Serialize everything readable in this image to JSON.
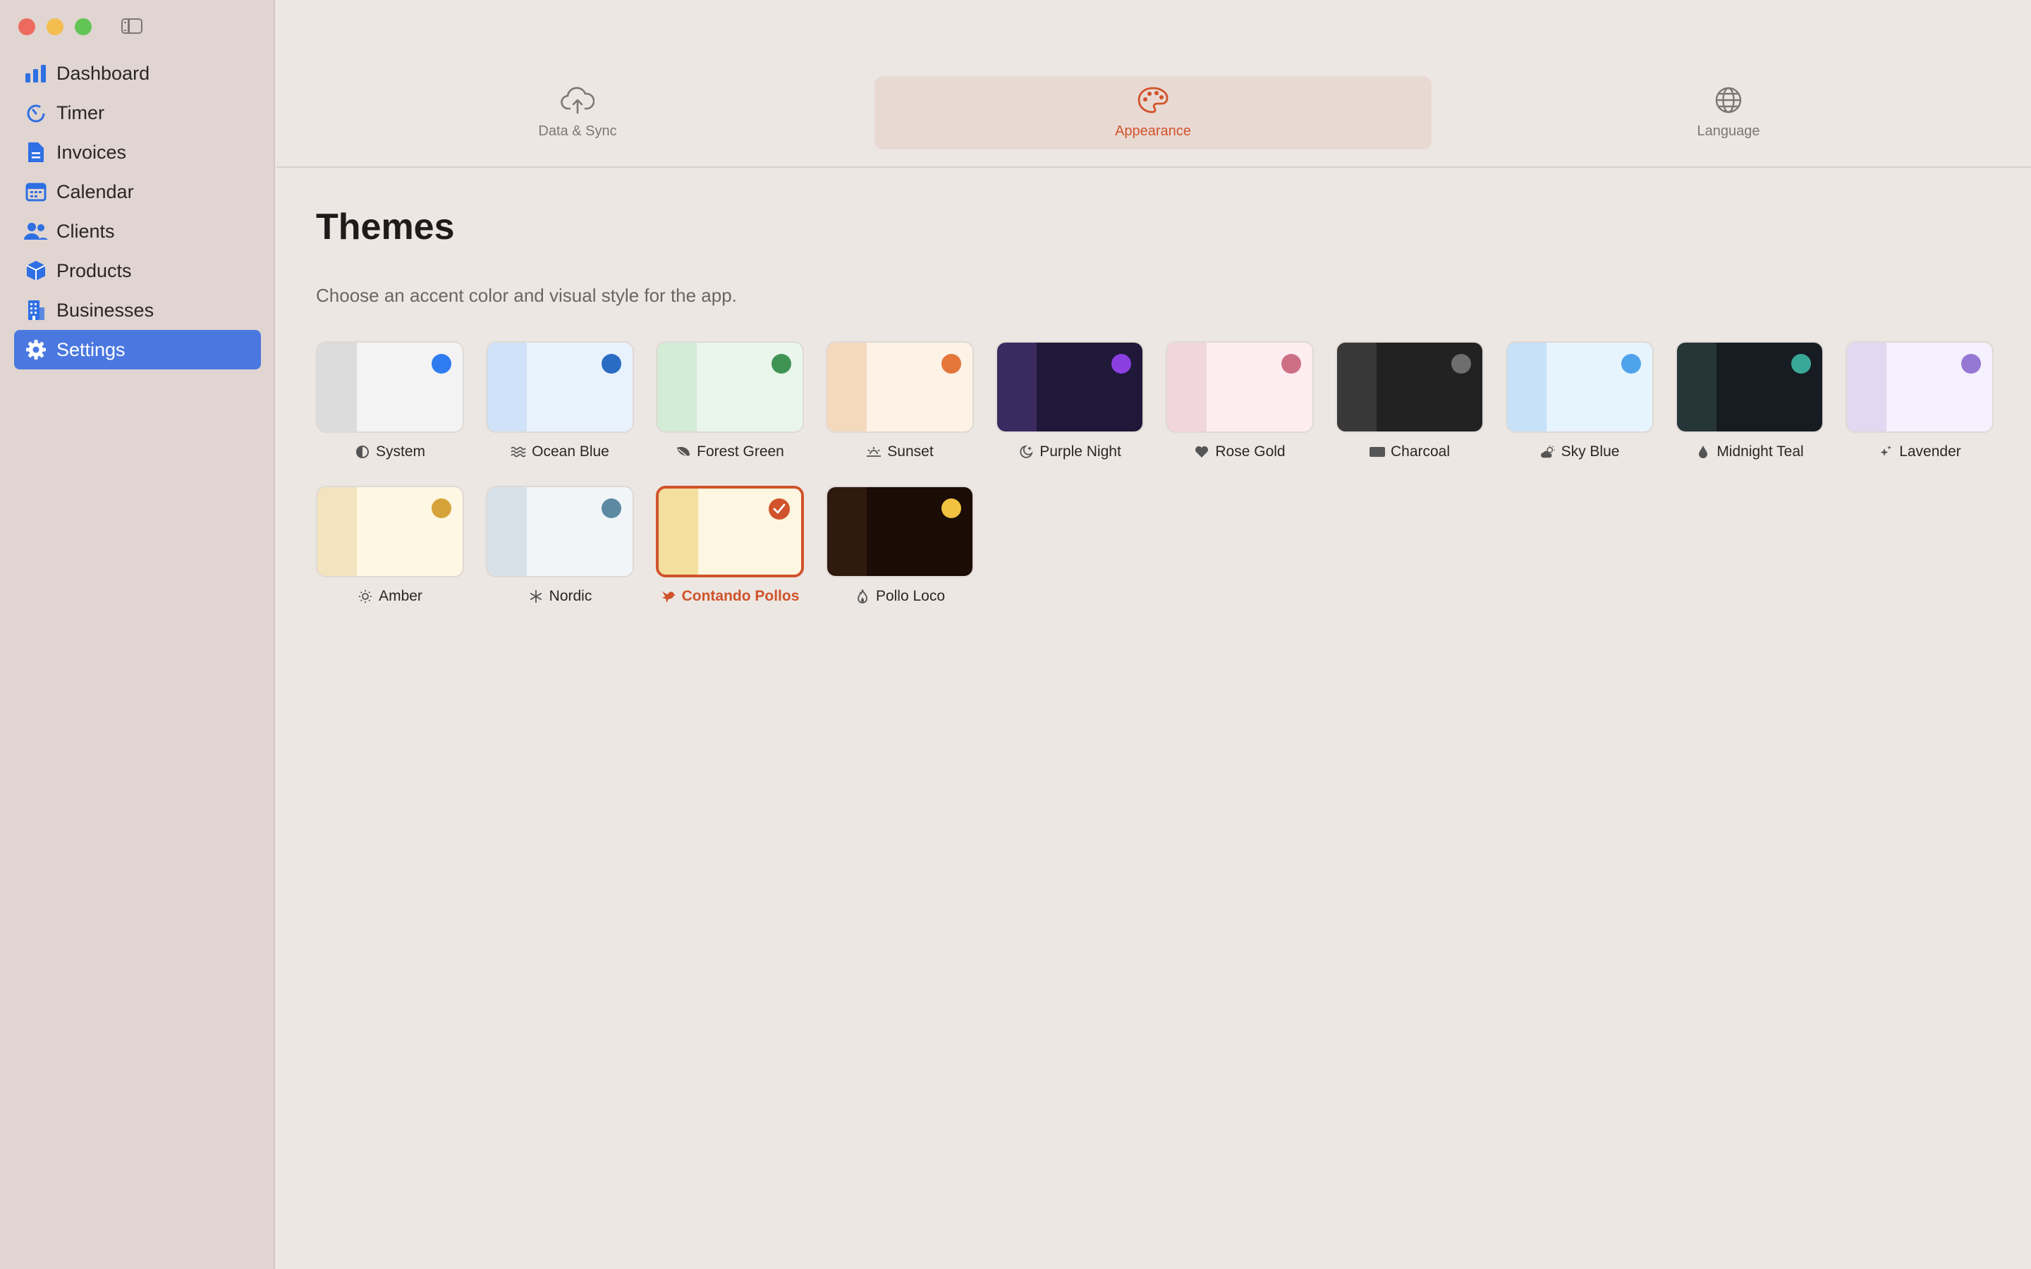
{
  "sidebar": {
    "items": [
      {
        "label": "Dashboard",
        "icon": "chart-bars-icon"
      },
      {
        "label": "Timer",
        "icon": "timer-icon"
      },
      {
        "label": "Invoices",
        "icon": "document-icon"
      },
      {
        "label": "Calendar",
        "icon": "calendar-icon"
      },
      {
        "label": "Clients",
        "icon": "people-icon"
      },
      {
        "label": "Products",
        "icon": "box-icon"
      },
      {
        "label": "Businesses",
        "icon": "building-icon"
      },
      {
        "label": "Settings",
        "icon": "gear-icon",
        "active": true
      }
    ]
  },
  "tabs": [
    {
      "label": "Data & Sync",
      "icon": "cloud-upload-icon"
    },
    {
      "label": "Appearance",
      "icon": "palette-icon",
      "active": true
    },
    {
      "label": "Language",
      "icon": "globe-icon"
    }
  ],
  "section": {
    "title": "Themes",
    "description": "Choose an accent color and visual style for the app."
  },
  "themes": [
    {
      "name": "System",
      "icon": "half-circle-icon",
      "strip": "#dcdcdc",
      "body": "#f3f3f3",
      "dot": "#2f7bf0"
    },
    {
      "name": "Ocean Blue",
      "icon": "waves-icon",
      "strip": "#cfe2f8",
      "body": "#e8f2fd",
      "dot": "#2a6cc4"
    },
    {
      "name": "Forest Green",
      "icon": "leaf-icon",
      "strip": "#d2ecd5",
      "body": "#eaf5ec",
      "dot": "#3f9454"
    },
    {
      "name": "Sunset",
      "icon": "sunset-icon",
      "strip": "#f4d9bd",
      "body": "#fdf2e6",
      "dot": "#e4763b"
    },
    {
      "name": "Purple Night",
      "icon": "moon-stars-icon",
      "strip": "#3a2a60",
      "body": "#1f1838",
      "dot": "#8b3fe0"
    },
    {
      "name": "Rose Gold",
      "icon": "heart-icon",
      "strip": "#f2d6de",
      "body": "#fdedf1",
      "dot": "#cd6f84"
    },
    {
      "name": "Charcoal",
      "icon": "rectangle-icon",
      "strip": "#383838",
      "body": "#222222",
      "dot": "#6e6e6e"
    },
    {
      "name": "Sky Blue",
      "icon": "cloud-sun-icon",
      "strip": "#c6e1f8",
      "body": "#e6f4fe",
      "dot": "#4fa3ec"
    },
    {
      "name": "Midnight Teal",
      "icon": "drop-icon",
      "strip": "#253538",
      "body": "#161c22",
      "dot": "#3aa899"
    },
    {
      "name": "Lavender",
      "icon": "sparkles-icon",
      "strip": "#e2d8f2",
      "body": "#f4f0fd",
      "dot": "#9577d4"
    },
    {
      "name": "Amber",
      "icon": "sun-icon",
      "strip": "#f3e4bf",
      "body": "#fdf7e3",
      "dot": "#d6a23a"
    },
    {
      "name": "Nordic",
      "icon": "snowflake-icon",
      "strip": "#d8e1e7",
      "body": "#f1f5f8",
      "dot": "#5d8aa3"
    },
    {
      "name": "Contando Pollos",
      "icon": "bird-icon",
      "strip": "#f5df9e",
      "body": "#fdf6e0",
      "dot": "#d0532b",
      "selected": true
    },
    {
      "name": "Pollo Loco",
      "icon": "flame-icon",
      "strip": "#301a0f",
      "body": "#1b0c05",
      "dot": "#f0c240"
    }
  ],
  "colors": {
    "accent": "#d0532b",
    "sidebar_active": "#4a78e0",
    "icon_blue": "#2f6fe4"
  }
}
